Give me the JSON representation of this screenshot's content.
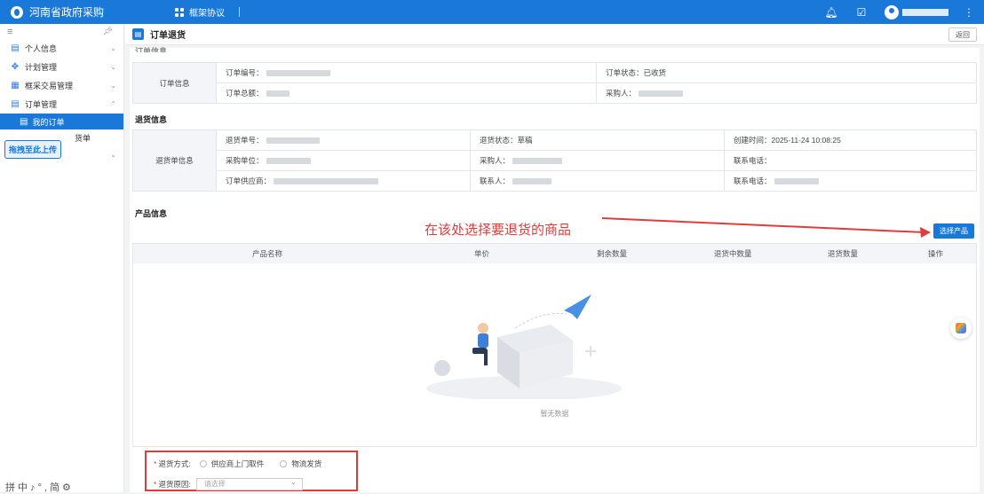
{
  "topbar": {
    "title": "河南省政府采购",
    "tab": "框架协议"
  },
  "sidebar": {
    "items": [
      {
        "label": "个人信息",
        "icon": "user-card-icon"
      },
      {
        "label": "计划管理",
        "icon": "grid-icon"
      },
      {
        "label": "框采交易管理",
        "icon": "trade-icon"
      },
      {
        "label": "订单管理",
        "icon": "order-icon"
      },
      {
        "label": "我的订单",
        "icon": "order-icon",
        "active": true
      },
      {
        "label": "货单",
        "icon": ""
      },
      {
        "label": "合同管理",
        "icon": "contract-icon"
      }
    ],
    "tooltip": "拖拽至此上传",
    "ime": "拼中♪°,简⚙"
  },
  "page": {
    "title": "订单退货",
    "back": "返回"
  },
  "order_info": {
    "section_title": "订单信息",
    "row_header": "订单信息",
    "order_no_label": "订单编号：",
    "order_status": "订单状态：已收货",
    "order_total_label": "订单总额：",
    "buyer_label": "采购人："
  },
  "return_info": {
    "section_title": "退货信息",
    "row_header": "退货单信息",
    "return_no_label": "退货单号：",
    "return_status": "退货状态：草稿",
    "created_time": "创建时间：2025-11-24 10:08:25",
    "purchase_unit_label": "采购单位：",
    "buyer_label": "采购人：",
    "contact_phone": "联系电话：",
    "supplier_label": "订单供应商：",
    "contact_person_label": "联系人：",
    "contact_phone2": "联系电话："
  },
  "product_info": {
    "section_title": "产品信息",
    "annotation": "在该处选择要退货的商品",
    "select_button": "选择产品",
    "columns": [
      "产品名称",
      "单价",
      "剩余数量",
      "退货中数量",
      "退货数量",
      "操作"
    ],
    "empty_text": "暂无数据"
  },
  "form": {
    "method_label": "退货方式:",
    "method_options": [
      "供应商上门取件",
      "物流发货"
    ],
    "reason_label": "退货原因:",
    "reason_placeholder": "请选择"
  },
  "colors": {
    "primary": "#1a79d8",
    "annotation_red": "#e23b3b"
  }
}
